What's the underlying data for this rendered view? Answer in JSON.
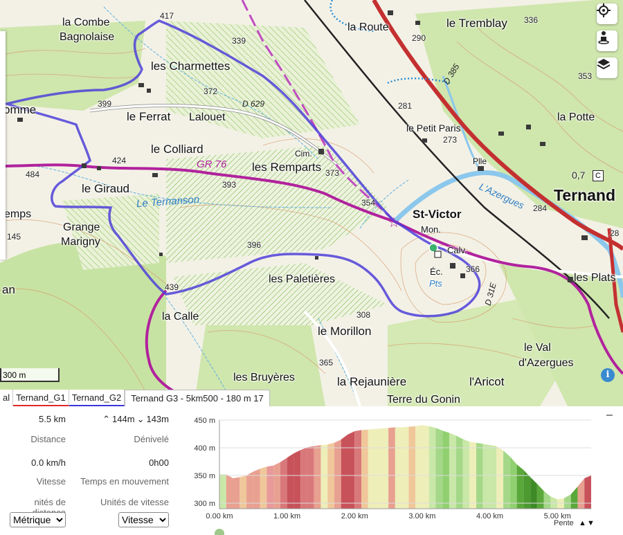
{
  "map": {
    "places": [
      {
        "label": "la Combe",
        "name": "place-la-combe"
      },
      {
        "label": "Bagnolaise",
        "name": "place-bagnolaise"
      },
      {
        "label": "les Charmettes",
        "name": "place-les-charmettes"
      },
      {
        "label": "omme",
        "name": "place-omme"
      },
      {
        "label": "le Ferrat",
        "name": "place-le-ferrat"
      },
      {
        "label": "Lalouet",
        "name": "place-lalouet"
      },
      {
        "label": "le Colliard",
        "name": "place-le-colliard"
      },
      {
        "label": "les Remparts",
        "name": "place-les-remparts"
      },
      {
        "label": "le Giraud",
        "name": "place-le-giraud"
      },
      {
        "label": "emps",
        "name": "place-emps"
      },
      {
        "label": "Grange",
        "name": "place-grange"
      },
      {
        "label": "Marigny",
        "name": "place-marigny"
      },
      {
        "label": "les Paletières",
        "name": "place-les-paletieres"
      },
      {
        "label": "la Calle",
        "name": "place-la-calle"
      },
      {
        "label": "le Morillon",
        "name": "place-le-morillon"
      },
      {
        "label": "les Bruyères",
        "name": "place-les-bruyeres"
      },
      {
        "label": "la Rejaunière",
        "name": "place-la-rejauniere"
      },
      {
        "label": "Terre du Gonin",
        "name": "place-terre-du-gonin"
      },
      {
        "label": "l'Aricot",
        "name": "place-laricot"
      },
      {
        "label": "le Val",
        "name": "place-le-val"
      },
      {
        "label": "d'Azergues",
        "name": "place-dazergues"
      },
      {
        "label": "les Plats",
        "name": "place-les-plats"
      },
      {
        "label": "St-Victor",
        "name": "place-st-victor"
      },
      {
        "label": "Ternand",
        "name": "place-ternand"
      },
      {
        "label": "la Potte",
        "name": "place-la-potte"
      },
      {
        "label": "le Petit Paris",
        "name": "place-le-petit-paris"
      },
      {
        "label": "la Route",
        "name": "place-la-route"
      },
      {
        "label": "le Tremblay",
        "name": "place-le-tremblay"
      },
      {
        "label": "Mon.",
        "name": "place-mon"
      },
      {
        "label": "Calv.",
        "name": "place-calv"
      },
      {
        "label": "Éc.",
        "name": "place-ec"
      },
      {
        "label": "Pts",
        "name": "place-pts"
      },
      {
        "label": "Cim.",
        "name": "place-cim"
      },
      {
        "label": "Plle",
        "name": "place-plle"
      },
      {
        "label": "an",
        "name": "place-an"
      }
    ],
    "altitudes": [
      "417",
      "339",
      "290",
      "336",
      "353",
      "372",
      "399",
      "424",
      "484",
      "393",
      "373",
      "354",
      "281",
      "273",
      "284",
      "396",
      "439",
      "366",
      "308",
      "365",
      "145",
      "28",
      "0,7"
    ],
    "roads": {
      "d629": "D 629",
      "d385": "D 385",
      "d31e": "D 31E",
      "gr76": "GR 76"
    },
    "water": {
      "ternanson": "Le Ternanson",
      "azergues": "L'Azergues"
    },
    "scale_label": "300 m"
  },
  "tabs": [
    {
      "label": "al"
    },
    {
      "label": "Ternand_G1"
    },
    {
      "label": "Ternand_G2"
    },
    {
      "label": "Ternand G3 - 5km500 - 180 m 17"
    }
  ],
  "stats": {
    "distance_value": "5.5 km",
    "distance_label": "Distance",
    "gain_value": "144m",
    "loss_value": "143m",
    "elevation_label": "Dénivelé",
    "speed_value": "0.0 km/h",
    "speed_label": "Vitesse",
    "moving_time_value": "0h00",
    "moving_time_label": "Temps en mouvement",
    "distance_units_label": "nités de distance",
    "speed_units_label": "Unités de vitesse",
    "distance_units_selected": "Métrique",
    "speed_units_selected": "Vitesse",
    "collapse_label": "–"
  },
  "chart_data": {
    "type": "area",
    "title": "",
    "xlabel": "",
    "ylabel": "",
    "x_unit": "km",
    "y_unit": "m",
    "xlim": [
      0,
      5.5
    ],
    "ylim": [
      290,
      450
    ],
    "x_ticks": [
      "0.00 km",
      "1.00 km",
      "2.00 km",
      "3.00 km",
      "4.00 km",
      "5.00 km"
    ],
    "y_ticks": [
      "300 m",
      "350 m",
      "400 m",
      "450 m"
    ],
    "legend_label": "Pente",
    "x": [
      0,
      0.1,
      0.2,
      0.3,
      0.4,
      0.5,
      0.6,
      0.7,
      0.8,
      0.9,
      1.0,
      1.1,
      1.2,
      1.3,
      1.4,
      1.5,
      1.6,
      1.7,
      1.8,
      1.9,
      2.0,
      2.1,
      2.2,
      2.3,
      2.4,
      2.5,
      2.6,
      2.7,
      2.8,
      2.9,
      3.0,
      3.1,
      3.2,
      3.3,
      3.4,
      3.5,
      3.6,
      3.7,
      3.8,
      3.9,
      4.0,
      4.1,
      4.2,
      4.3,
      4.4,
      4.5,
      4.6,
      4.7,
      4.8,
      4.9,
      5.0,
      5.1,
      5.2,
      5.3,
      5.4,
      5.5
    ],
    "elevation": [
      352,
      352,
      345,
      347,
      350,
      357,
      362,
      366,
      368,
      374,
      382,
      390,
      396,
      401,
      403,
      405,
      406,
      409,
      415,
      424,
      430,
      432,
      433,
      434,
      435,
      436,
      437,
      437,
      438,
      439,
      441,
      439,
      436,
      431,
      427,
      422,
      416,
      411,
      409,
      407,
      405,
      403,
      395,
      384,
      370,
      360,
      347,
      335,
      322,
      312,
      307,
      309,
      316,
      330,
      345,
      350
    ],
    "slope_colors": [
      "#c9e8a8",
      "#e8a090",
      "#e8a090",
      "#f0c79a",
      "#e8a090",
      "#e8a090",
      "#f0c79a",
      "#e89999",
      "#e8a090",
      "#d9787a",
      "#c8525a",
      "#c8525a",
      "#d9787a",
      "#d9787a",
      "#e8a090",
      "#eeeeb8",
      "#f0c79a",
      "#e8a090",
      "#c8525a",
      "#c8525a",
      "#d9787a",
      "#f0c79a",
      "#eeeeb8",
      "#eeeeb8",
      "#eeeeb8",
      "#e8a090",
      "#eeeeb8",
      "#eeeeb8",
      "#f0c79a",
      "#eeeeb8",
      "#eeeeb8",
      "#c9e8a8",
      "#a4d888",
      "#90d070",
      "#c9e8a8",
      "#a4d888",
      "#c9e8a8",
      "#eeeeb8",
      "#a4d888",
      "#c9e8a8",
      "#c9e8a8",
      "#eeeeb8",
      "#a4d888",
      "#90d070",
      "#5aa83a",
      "#4c9a30",
      "#3e8a26",
      "#5aa83a",
      "#a4d888",
      "#c9e8a8",
      "#eeeeb8",
      "#a4d888",
      "#5aa83a",
      "#e8a090",
      "#c8525a",
      "#c8525a"
    ]
  }
}
